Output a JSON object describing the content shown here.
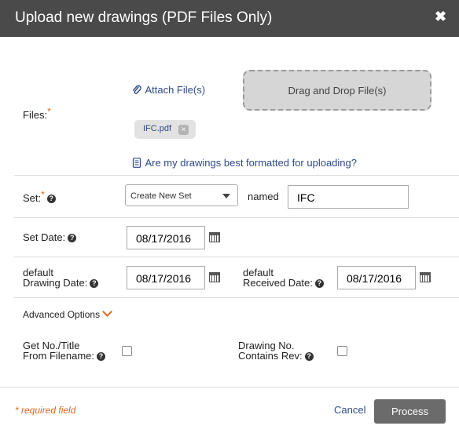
{
  "dialog": {
    "title": "Upload new drawings (PDF Files Only)",
    "close_symbol": "✖"
  },
  "files": {
    "label": "Files:",
    "required_mark": "*",
    "attach_label": "Attach File(s)",
    "dropzone_label": "Drag and Drop File(s)",
    "attached_file": "IFC.pdf",
    "remove_symbol": "×",
    "help_link": "Are my drawings best formatted for uploading?"
  },
  "set": {
    "label": "Set:",
    "required_mark": "*",
    "select_value": "Create New Set",
    "named_label": "named",
    "name_value": "IFC"
  },
  "set_date": {
    "label": "Set Date:",
    "value": "08/17/2016"
  },
  "drawing_date": {
    "label_line1": "default",
    "label_line2": "Drawing Date:",
    "value": "08/17/2016"
  },
  "received_date": {
    "label_line1": "default",
    "label_line2": "Received Date:",
    "value": "08/17/2016"
  },
  "advanced": {
    "label": "Advanced Options"
  },
  "get_no_title": {
    "label_line1": "Get No./Title",
    "label_line2": "From Filename:",
    "checked": false
  },
  "drawing_no_rev": {
    "label_line1": "Drawing No.",
    "label_line2": "Contains Rev:",
    "checked": false
  },
  "footer": {
    "required_note": "* required field",
    "cancel_label": "Cancel",
    "process_label": "Process"
  },
  "help_symbol": "?",
  "colors": {
    "header_bg": "#4a4a4a",
    "accent": "#e0661d",
    "link": "#2e4a8a",
    "process_bg": "#6b6b6b"
  }
}
